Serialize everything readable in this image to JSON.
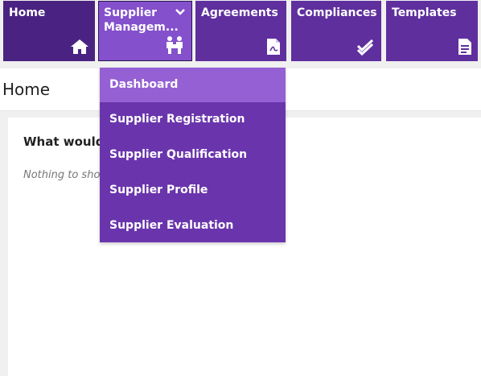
{
  "nav": {
    "tiles": [
      {
        "label": "Home",
        "icon": "home-icon"
      },
      {
        "label": "Supplier Managem...",
        "icon": "users-icon",
        "active": true
      },
      {
        "label": "Agreements",
        "icon": "pdf-document-icon"
      },
      {
        "label": "Compliances",
        "icon": "double-check-icon"
      },
      {
        "label": "Templates",
        "icon": "template-document-icon"
      }
    ]
  },
  "dropdown": {
    "items": [
      {
        "label": "Dashboard",
        "selected": true
      },
      {
        "label": "Supplier Registration"
      },
      {
        "label": "Supplier Qualification"
      },
      {
        "label": "Supplier Profile"
      },
      {
        "label": "Supplier Evaluation"
      }
    ]
  },
  "page": {
    "title": "Home",
    "question": "What would you like to do?",
    "empty_text": "Nothing to show"
  },
  "colors": {
    "tile": "#5f2f9e",
    "tile_home": "#4a2382",
    "tile_active": "#8450cc",
    "dropdown_bg": "#6a35ac",
    "dropdown_selected": "#9460d4"
  }
}
